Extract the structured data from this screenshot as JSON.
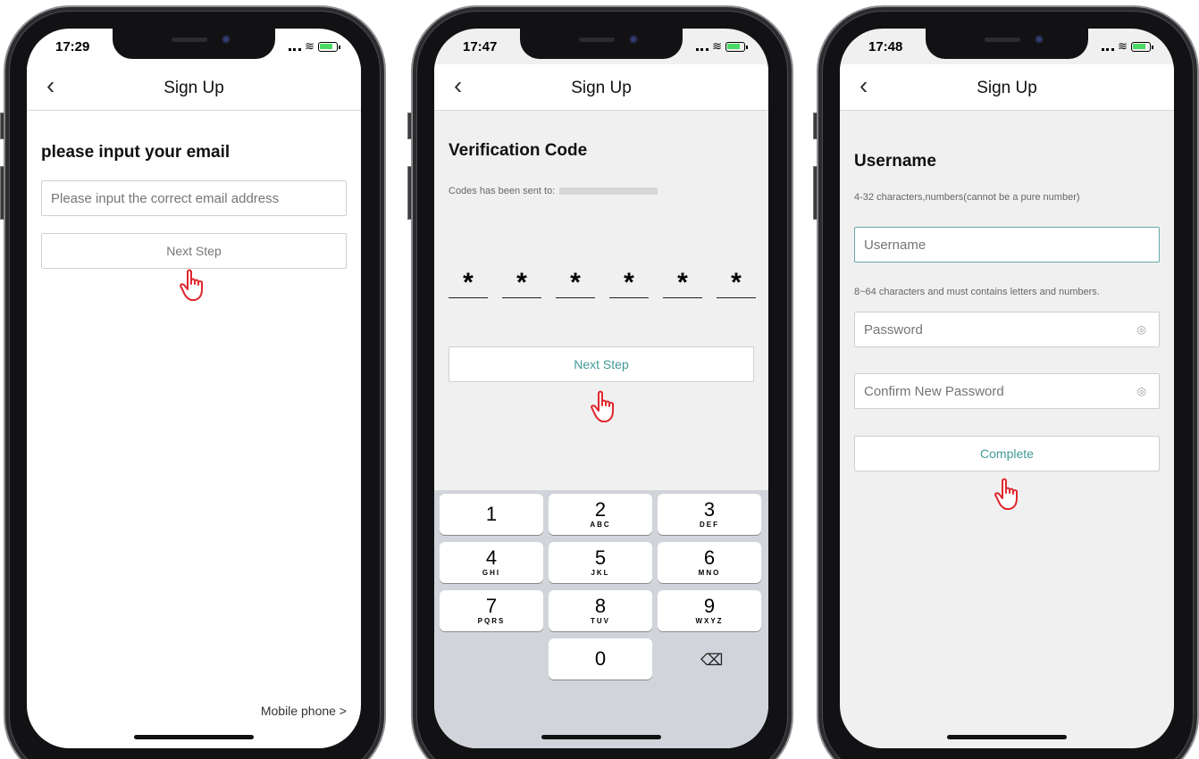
{
  "screens": [
    {
      "time": "17:29",
      "title": "Sign Up",
      "heading": "please input your email",
      "email_placeholder": "Please input the correct email address",
      "next_label": "Next Step",
      "footer_link": "Mobile phone >"
    },
    {
      "time": "17:47",
      "title": "Sign Up",
      "heading": "Verification Code",
      "sent_text": "Codes has been sent to:",
      "code_digits": [
        "*",
        "*",
        "*",
        "*",
        "*",
        "*"
      ],
      "next_label": "Next Step",
      "keypad": [
        {
          "num": "1",
          "sub": ""
        },
        {
          "num": "2",
          "sub": "ABC"
        },
        {
          "num": "3",
          "sub": "DEF"
        },
        {
          "num": "4",
          "sub": "GHI"
        },
        {
          "num": "5",
          "sub": "JKL"
        },
        {
          "num": "6",
          "sub": "MNO"
        },
        {
          "num": "7",
          "sub": "PQRS"
        },
        {
          "num": "8",
          "sub": "TUV"
        },
        {
          "num": "9",
          "sub": "WXYZ"
        },
        {
          "num": "0",
          "sub": ""
        }
      ],
      "backspace_glyph": "⌫"
    },
    {
      "time": "17:48",
      "title": "Sign Up",
      "heading": "Username",
      "username_hint": "4-32 characters,numbers(cannot be a pure number)",
      "username_placeholder": "Username",
      "password_hint": "8~64 characters and must contains letters and numbers.",
      "password_placeholder": "Password",
      "confirm_placeholder": "Confirm New Password",
      "complete_label": "Complete"
    }
  ],
  "colors": {
    "accent": "#3f9a98",
    "hand_cursor": "#e0282e"
  },
  "icons": [
    "back-chevron-icon",
    "wifi-icon",
    "battery-icon",
    "eye-slash-icon",
    "hand-pointer-icon",
    "backspace-icon"
  ]
}
